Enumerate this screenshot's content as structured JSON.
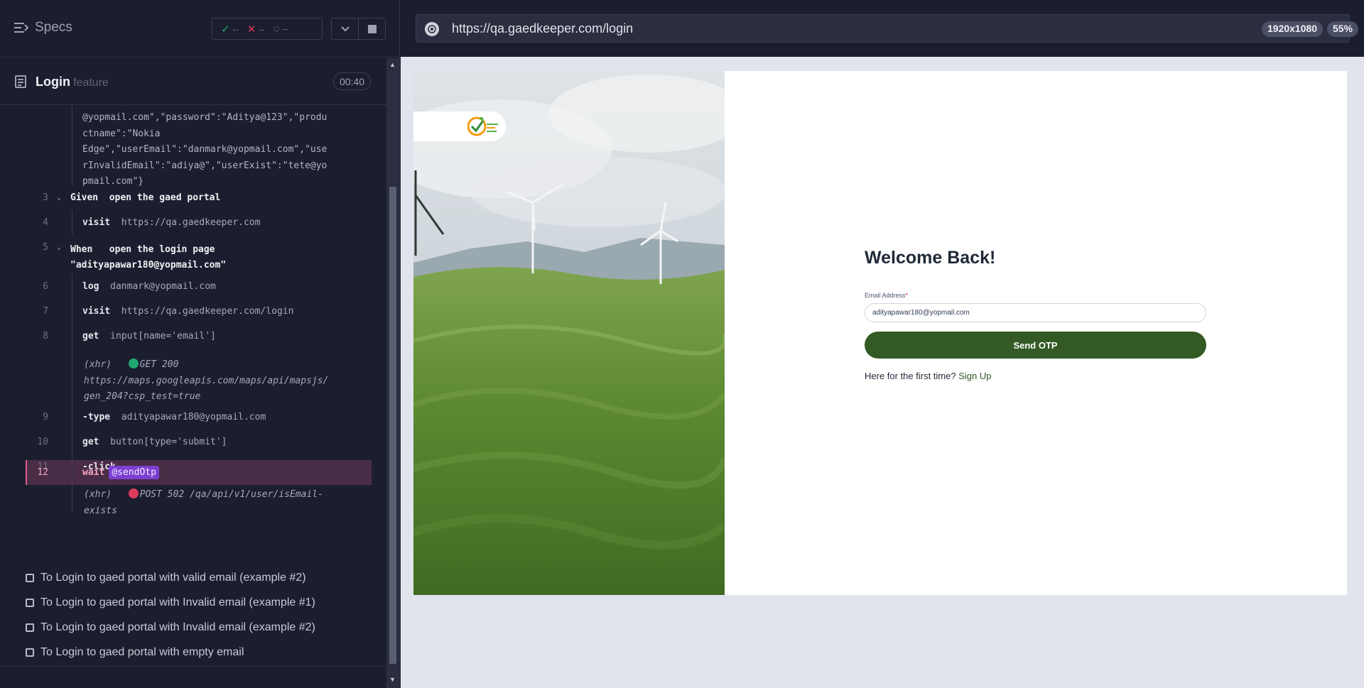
{
  "reporter": {
    "specs_label": "Specs",
    "stats": {
      "passed": "--",
      "failed": "--",
      "pending": "--"
    },
    "feature": {
      "name": "Login",
      "kind": "feature",
      "duration": "00:40"
    },
    "commands": [
      {
        "json_lines": [
          "@yopmail.com\",\"password\":\"Aditya@123\",\"produ",
          "ctname\":\"Nokia",
          "Edge\",\"userEmail\":\"danmark@yopmail.com\",\"use",
          "rInvalidEmail\":\"adiya@\",\"userExist\":\"tete@yo",
          "pmail.com\"}"
        ]
      },
      {
        "num": "3",
        "keyword": "Given",
        "text": "open the gaed portal"
      },
      {
        "num": "4",
        "name": "visit",
        "arg": "https://qa.gaedkeeper.com"
      },
      {
        "num": "5",
        "keyword": "When",
        "text": "open the login page",
        "text2": "\"adityapawar180@yopmail.com\""
      },
      {
        "num": "6",
        "name": "log",
        "arg": "danmark@yopmail.com"
      },
      {
        "num": "7",
        "name": "visit",
        "arg": "https://qa.gaedkeeper.com/login"
      },
      {
        "num": "8",
        "name": "get",
        "arg": "input[name='email']"
      },
      {
        "xhr": "(xhr)",
        "method": "GET 200",
        "url1": "https://maps.googleapis.com/maps/api/mapsjs/",
        "url2": "gen_204?csp_test=true"
      },
      {
        "num": "9",
        "name": "-type",
        "arg": "adityapawar180@yopmail.com"
      },
      {
        "num": "10",
        "name": "get",
        "arg": "button[type='submit']"
      },
      {
        "num": "11",
        "name": "-click"
      },
      {
        "num": "12",
        "name": "wait",
        "alias": "@sendOtp"
      },
      {
        "xhr": "(xhr)",
        "method": "POST 502 /qa/api/v1/user/isEmail-",
        "url2": "exists"
      }
    ],
    "tests": [
      "To Login to gaed portal with valid email (example #2)",
      "To Login to gaed portal with Invalid email (example #1)",
      "To Login to gaed portal with Invalid email (example #2)",
      "To Login to gaed portal with empty email"
    ]
  },
  "browser": {
    "url": "https://qa.gaedkeeper.com/login",
    "viewport": "1920x1080",
    "zoom": "55%"
  },
  "page": {
    "heading": "Welcome Back!",
    "email_label": "Email Address",
    "email_required": "*",
    "email_value": "adityapawar180@yopmail.com",
    "submit_label": "Send OTP",
    "signup_prompt": "Here for the first time?",
    "signup_link": "Sign Up"
  },
  "colors": {
    "success": "#1fa971",
    "failure": "#e03a5a",
    "alias": "#7c3fd1",
    "brand_green": "#335a24"
  }
}
